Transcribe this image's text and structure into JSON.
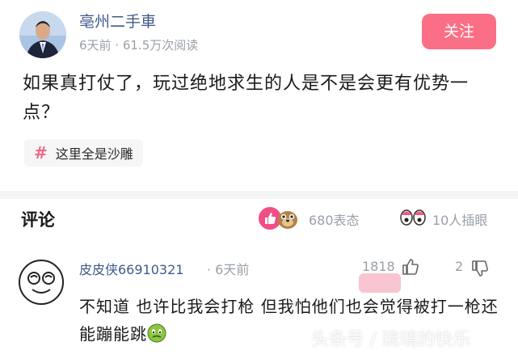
{
  "post": {
    "author": "亳州二手車",
    "meta": "6天前 · 61.5万次阅读",
    "follow_label": "关注",
    "text": "如果真打仗了，玩过绝地求生的人是不是会更有优势一点？",
    "topic": "这里全是沙雕"
  },
  "comments_section": {
    "title": "评论",
    "reaction_count": "680表态",
    "insight_count": "10人插眼"
  },
  "comment": {
    "user": "皮皮侠66910321",
    "time": "· 6天前",
    "likes": "1818",
    "dislikes": "2",
    "text": "不知道 也许比我会打枪 但我怕他们也会觉得被打一枪还能蹦能跳"
  },
  "watermark": {
    "text": "头条号 / 琉璃的快乐"
  },
  "colors": {
    "accent": "#fb6f86",
    "link_name": "#3f5a8a",
    "muted": "#9aa0a8"
  }
}
